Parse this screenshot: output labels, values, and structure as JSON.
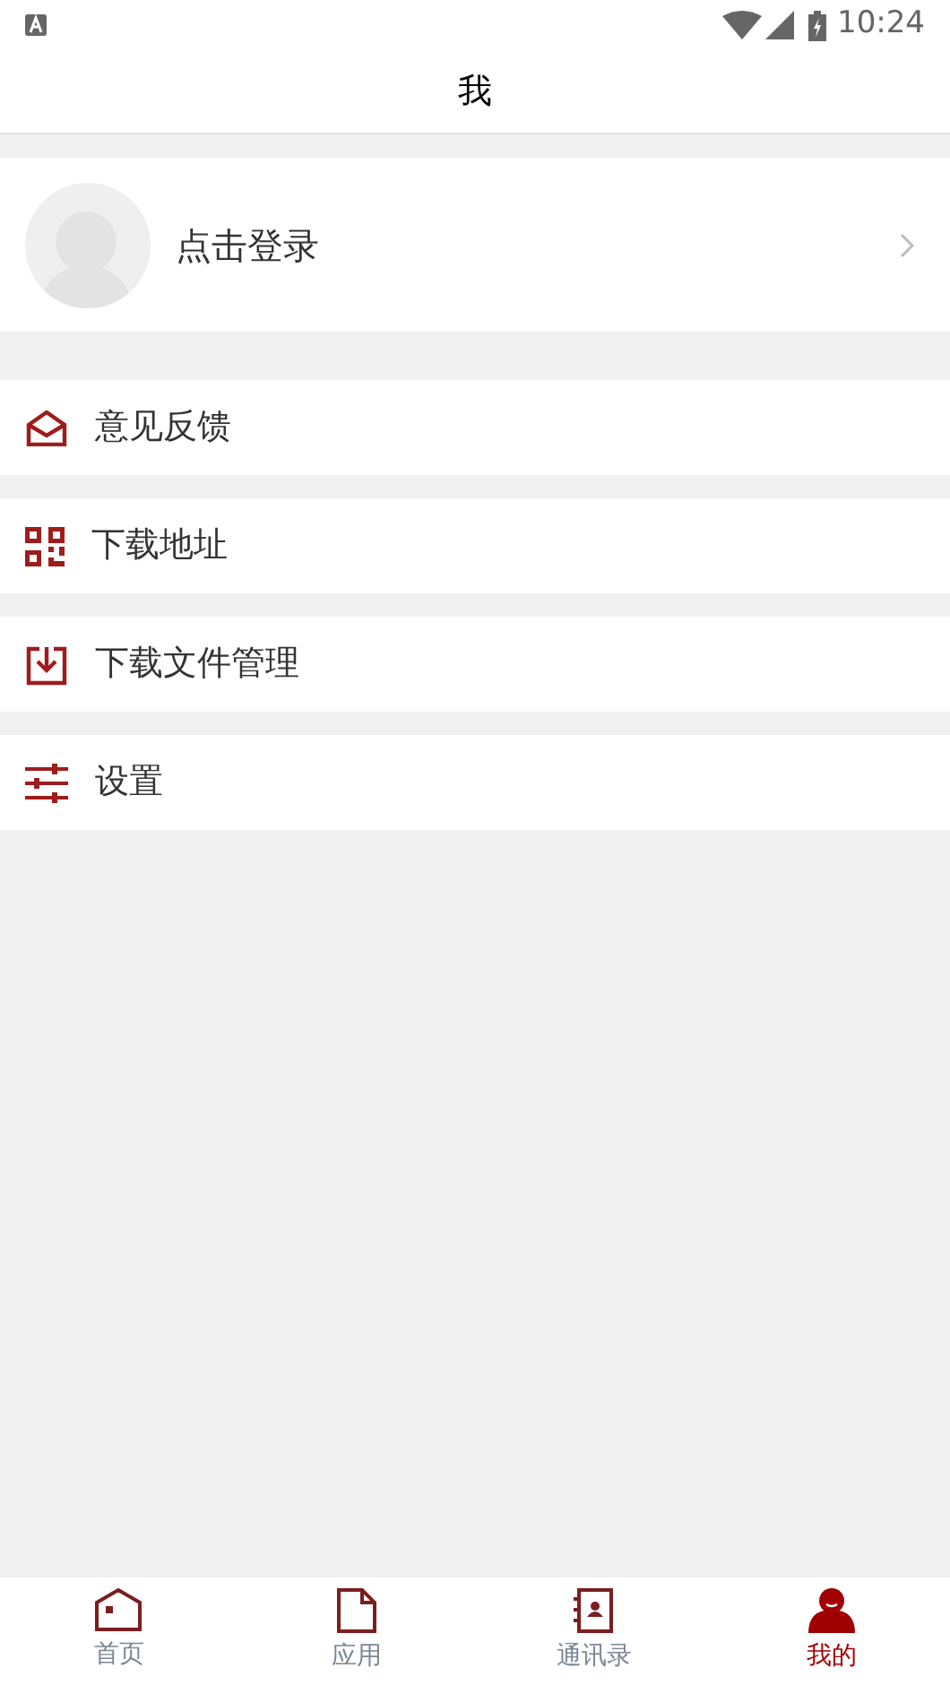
{
  "status_bar": {
    "time": "10:24"
  },
  "header": {
    "title": "我"
  },
  "login": {
    "label": "点击登录"
  },
  "menu": [
    {
      "kind": "mail",
      "label": "意见反馈"
    },
    {
      "kind": "qr",
      "label": "下载地址"
    },
    {
      "kind": "download",
      "label": "下载文件管理"
    },
    {
      "kind": "sliders",
      "label": "设置"
    }
  ],
  "tabs": [
    {
      "kind": "home",
      "label": "首页",
      "selected": false
    },
    {
      "kind": "doc",
      "label": "应用",
      "selected": false
    },
    {
      "kind": "contacts",
      "label": "通讯录",
      "selected": false
    },
    {
      "kind": "user",
      "label": "我的",
      "selected": true
    }
  ]
}
